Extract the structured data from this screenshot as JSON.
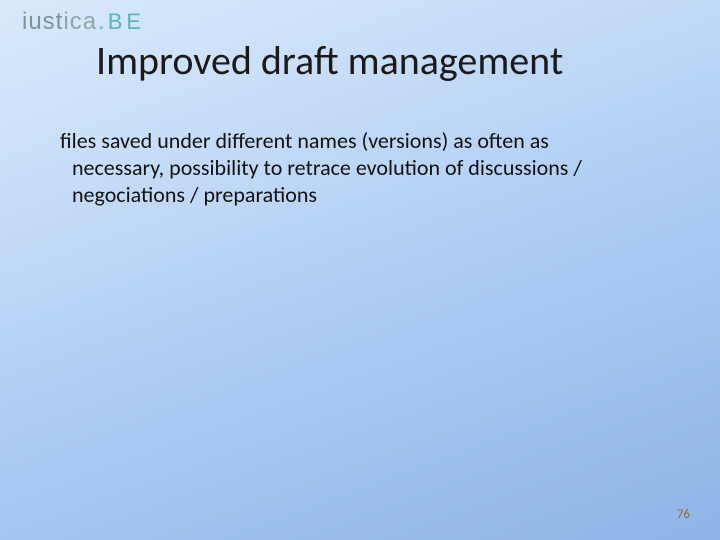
{
  "logo": {
    "part1": "iust",
    "part2": "ica",
    "dot": ".",
    "suffix": "BE"
  },
  "title": "Improved draft management",
  "body_text": "files saved under different names (versions) as often as necessary, possibility to retrace evolution of discussions / negociations / preparations",
  "page_number": "76"
}
